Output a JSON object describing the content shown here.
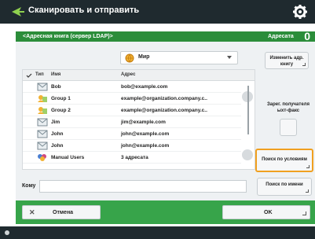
{
  "app": {
    "title": "Сканировать и отправить",
    "icon": "scan-send-icon",
    "settings_icon": "gear-icon"
  },
  "header": {
    "path": "<Адресная книга (сервер LDAP)>",
    "count_label": "Адресата",
    "count_value": "0"
  },
  "filter": {
    "selected": "Мир",
    "icon": "globe-icon"
  },
  "side": {
    "change_addressbook": "Изменить адр. книгу",
    "register_fax": "Зарег. получателя ыхт-факс",
    "search_conditions": "Поиск по условиям",
    "search_by_name": "Поиск по имени"
  },
  "list": {
    "columns": [
      "Тип",
      "Имя",
      "Адрес"
    ],
    "rows": [
      {
        "icon": "email-icon",
        "name": "Bob",
        "address": "bob@example.com"
      },
      {
        "icon": "group-icon",
        "name": "Group 1",
        "address": "example@organization.company.c.."
      },
      {
        "icon": "group-icon",
        "name": "Group 2",
        "address": "example@organization.company.c.."
      },
      {
        "icon": "email-icon",
        "name": "Jim",
        "address": "jim@example.com"
      },
      {
        "icon": "email-icon",
        "name": "John",
        "address": "john@example.com"
      },
      {
        "icon": "email-icon",
        "name": "John",
        "address": "john@example.com"
      },
      {
        "icon": "group-multi-icon",
        "name": "Manual Users",
        "address": "3 адресата"
      }
    ]
  },
  "to": {
    "label": "Кому",
    "value": ""
  },
  "buttons": {
    "cancel": "Отмена",
    "ok": "OK"
  },
  "colors": {
    "accent_green": "#2b8d3a",
    "bottom_green": "#37a44a",
    "dark_bar": "#1f2a2f",
    "highlight": "#f0a020"
  }
}
